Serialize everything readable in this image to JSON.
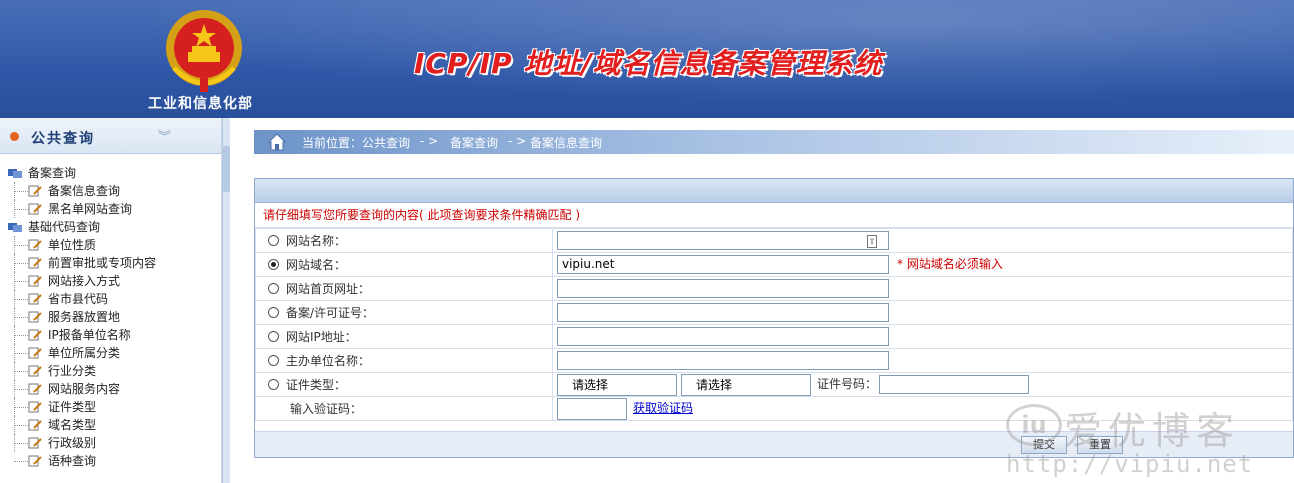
{
  "header": {
    "ministry": "工业和信息化部",
    "system_title": "ICP/IP 地址/域名信息备案管理系统"
  },
  "sidebar": {
    "title": "公共查询",
    "groups": [
      {
        "label": "备案查询",
        "items": [
          "备案信息查询",
          "黑名单网站查询"
        ]
      },
      {
        "label": "基础代码查询",
        "items": [
          "单位性质",
          "前置审批或专项内容",
          "网站接入方式",
          "省市县代码",
          "服务器放置地",
          "IP报备单位名称",
          "单位所属分类",
          "行业分类",
          "网站服务内容",
          "证件类型",
          "域名类型",
          "行政级别",
          "语种查询"
        ]
      }
    ]
  },
  "breadcrumb": {
    "current": "当前位置：公共查询",
    "sep1": "- >",
    "level2": "备案查询",
    "sep2": "- >",
    "level3": "备案信息查询"
  },
  "form": {
    "notice": "请仔细填写您所要查询的内容( 此项查询要求条件精确匹配 )",
    "fields": [
      {
        "label": "网站名称：",
        "value": "",
        "checked": false
      },
      {
        "label": "网站域名：",
        "value": "vipiu.net",
        "checked": true,
        "required_note": "* 网站域名必须输入"
      },
      {
        "label": "网站首页网址：",
        "value": "",
        "checked": false
      },
      {
        "label": "备案/许可证号：",
        "value": "",
        "checked": false
      },
      {
        "label": "网站IP地址：",
        "value": "",
        "checked": false
      },
      {
        "label": "主办单位名称：",
        "value": "",
        "checked": false
      },
      {
        "label": "证件类型：",
        "value": "",
        "checked": false
      }
    ],
    "cert_select_1": "请选择",
    "cert_select_2": "请选择",
    "cert_no_label": "证件号码：",
    "captcha_label": "输入验证码：",
    "get_captcha": "获取验证码",
    "submit": "提交",
    "reset": "重置"
  },
  "watermark": {
    "brand": "爱优博客",
    "url": "http://vipiu.net"
  },
  "colors": {
    "header_blue": "#2f58a8",
    "title_red": "#e21e1e",
    "notice_red": "#cc0000",
    "link_blue": "#0000cc"
  }
}
